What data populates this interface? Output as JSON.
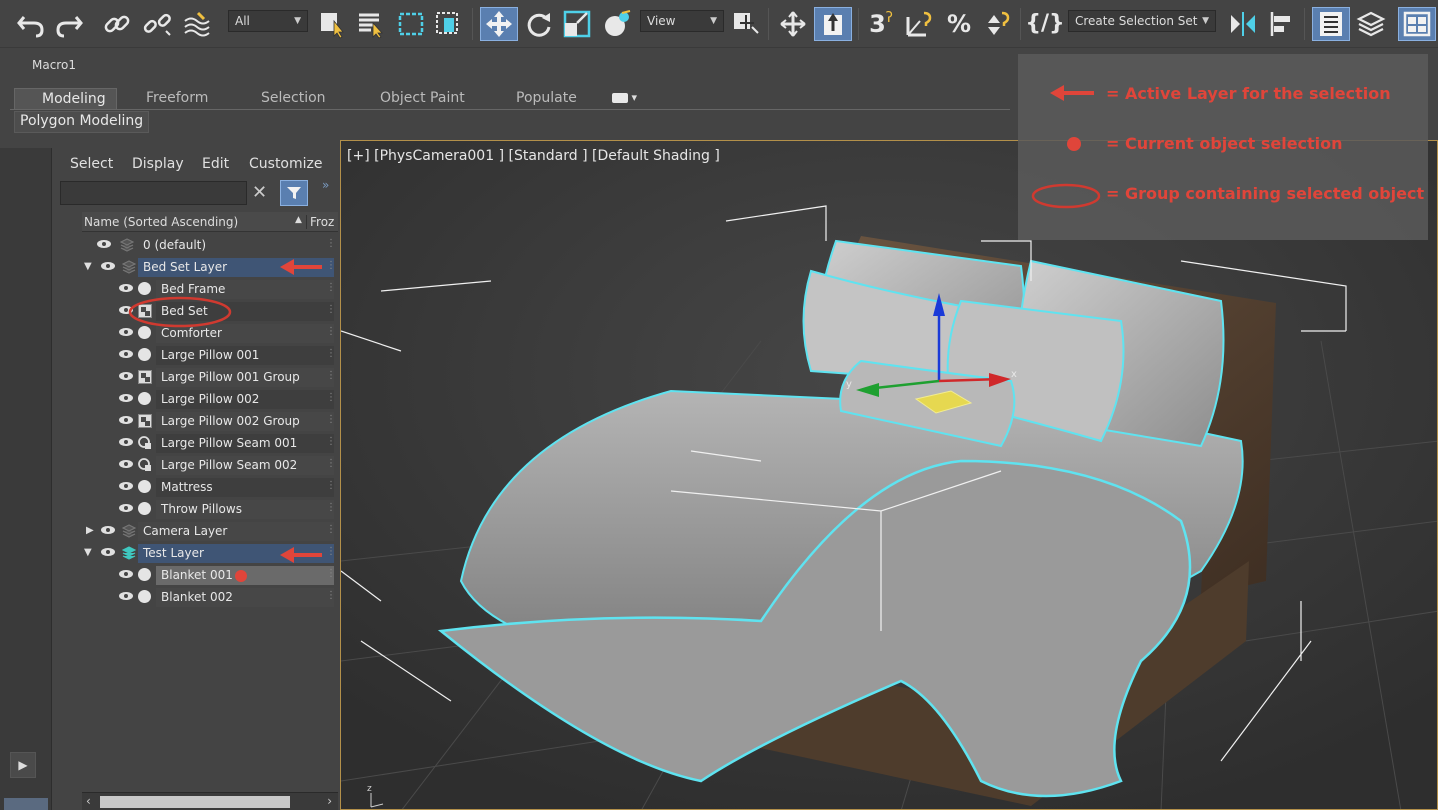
{
  "toolbar": {
    "filter_value": "All",
    "ref_coord_value": "View",
    "selection_set_value": "Create Selection Set",
    "snap_angle_label": "3",
    "icons": [
      "undo-icon",
      "redo-icon",
      "link-icon",
      "unlink-icon",
      "bind-space-warp-icon",
      "select-object-icon",
      "select-by-name-icon",
      "rect-selection-icon",
      "window-crossing-icon",
      "move-icon",
      "rotate-icon",
      "scale-icon",
      "placement-icon",
      "pivot-icon",
      "manipulate-icon",
      "keyboard-shortcut-icon",
      "snap-3d-icon",
      "angle-snap-icon",
      "percent-snap-icon",
      "spinner-snap-icon",
      "named-selection-icon",
      "mirror-icon",
      "align-icon",
      "toggle-scene-explorer-icon",
      "toggle-layer-explorer-icon",
      "toggle-ribbon-icon"
    ]
  },
  "macro": {
    "label": "Macro1"
  },
  "ribbon": {
    "tabs": [
      "Modeling",
      "Freeform",
      "Selection",
      "Object Paint",
      "Populate"
    ],
    "active_tab": "Modeling",
    "panel_label": "Polygon Modeling"
  },
  "explorer": {
    "menu": [
      "Select",
      "Display",
      "Edit",
      "Customize"
    ],
    "search_placeholder": "",
    "column_name": "Name (Sorted Ascending)",
    "column_frozen": "Froz",
    "rows": [
      {
        "label": "0 (default)"
      },
      {
        "label": "Bed Set Layer"
      },
      {
        "label": "Bed Frame"
      },
      {
        "label": "Bed Set"
      },
      {
        "label": "Comforter"
      },
      {
        "label": "Large Pillow 001"
      },
      {
        "label": "Large Pillow 001 Group"
      },
      {
        "label": "Large Pillow 002"
      },
      {
        "label": "Large Pillow 002 Group"
      },
      {
        "label": "Large Pillow Seam 001"
      },
      {
        "label": "Large Pillow Seam 002"
      },
      {
        "label": "Mattress"
      },
      {
        "label": "Throw Pillows"
      },
      {
        "label": "Camera Layer"
      },
      {
        "label": "Test Layer"
      },
      {
        "label": "Blanket 001"
      },
      {
        "label": "Blanket 002"
      }
    ]
  },
  "viewport": {
    "label": "[+] [PhysCamera001 ] [Standard ] [Default Shading ]",
    "gizmo_axes": [
      "x",
      "y",
      "z"
    ]
  },
  "legend": {
    "items": [
      {
        "text": "= Active Layer for the selection"
      },
      {
        "text": "= Current object selection"
      },
      {
        "text": "= Group containing selected object"
      }
    ],
    "colors": {
      "annotation": "#e0453a",
      "selection_outline": "#5fe3f0",
      "active_tool": "#5a7fb0"
    }
  }
}
